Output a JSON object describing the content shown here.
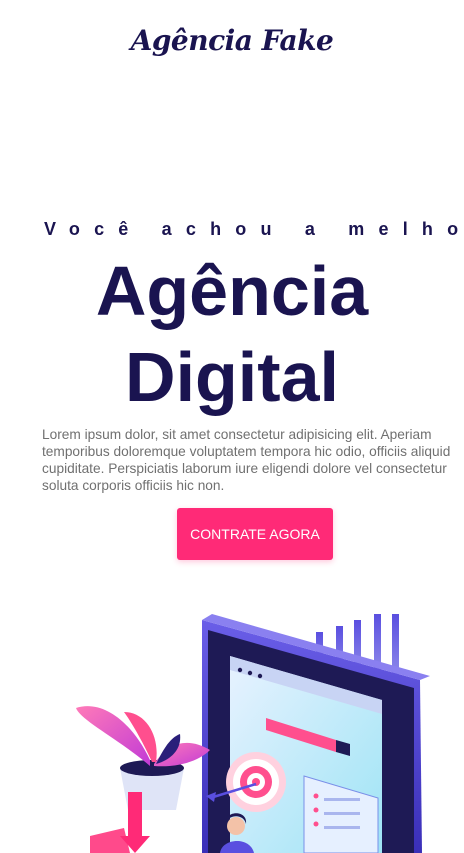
{
  "header": {
    "brand": "Agência Fake"
  },
  "hero": {
    "tagline": "Você achou a melhor",
    "title_line1": "Agência",
    "title_line2": "Digital",
    "description": "Lorem ipsum dolor, sit amet consectetur adipisicing elit. Aperiam temporibus doloremque voluptatem tempora hic odio, officiis aliquid cupiditate. Perspiciatis laborum iure eligendi dolore vel consectetur soluta corporis officiis hic non.",
    "cta_label": "CONTRATE AGORA"
  },
  "colors": {
    "brand_navy": "#1a1450",
    "accent_pink": "#ff2a77",
    "body_text": "#707070"
  }
}
